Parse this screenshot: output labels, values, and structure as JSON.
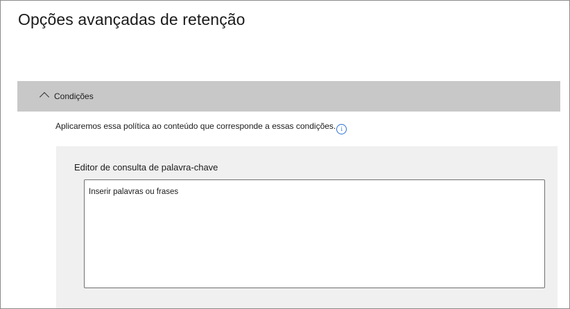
{
  "page": {
    "title": "Opções avançadas de retenção"
  },
  "conditions": {
    "header_label": "Condições",
    "expanded": true,
    "description": "Aplicaremos essa política ao conteúdo que corresponde a essas condições.",
    "info_icon": "info-icon"
  },
  "keyword_editor": {
    "label": "Editor de consulta de palavra-chave",
    "value": "",
    "placeholder": "Inserir palavras ou frases"
  }
}
